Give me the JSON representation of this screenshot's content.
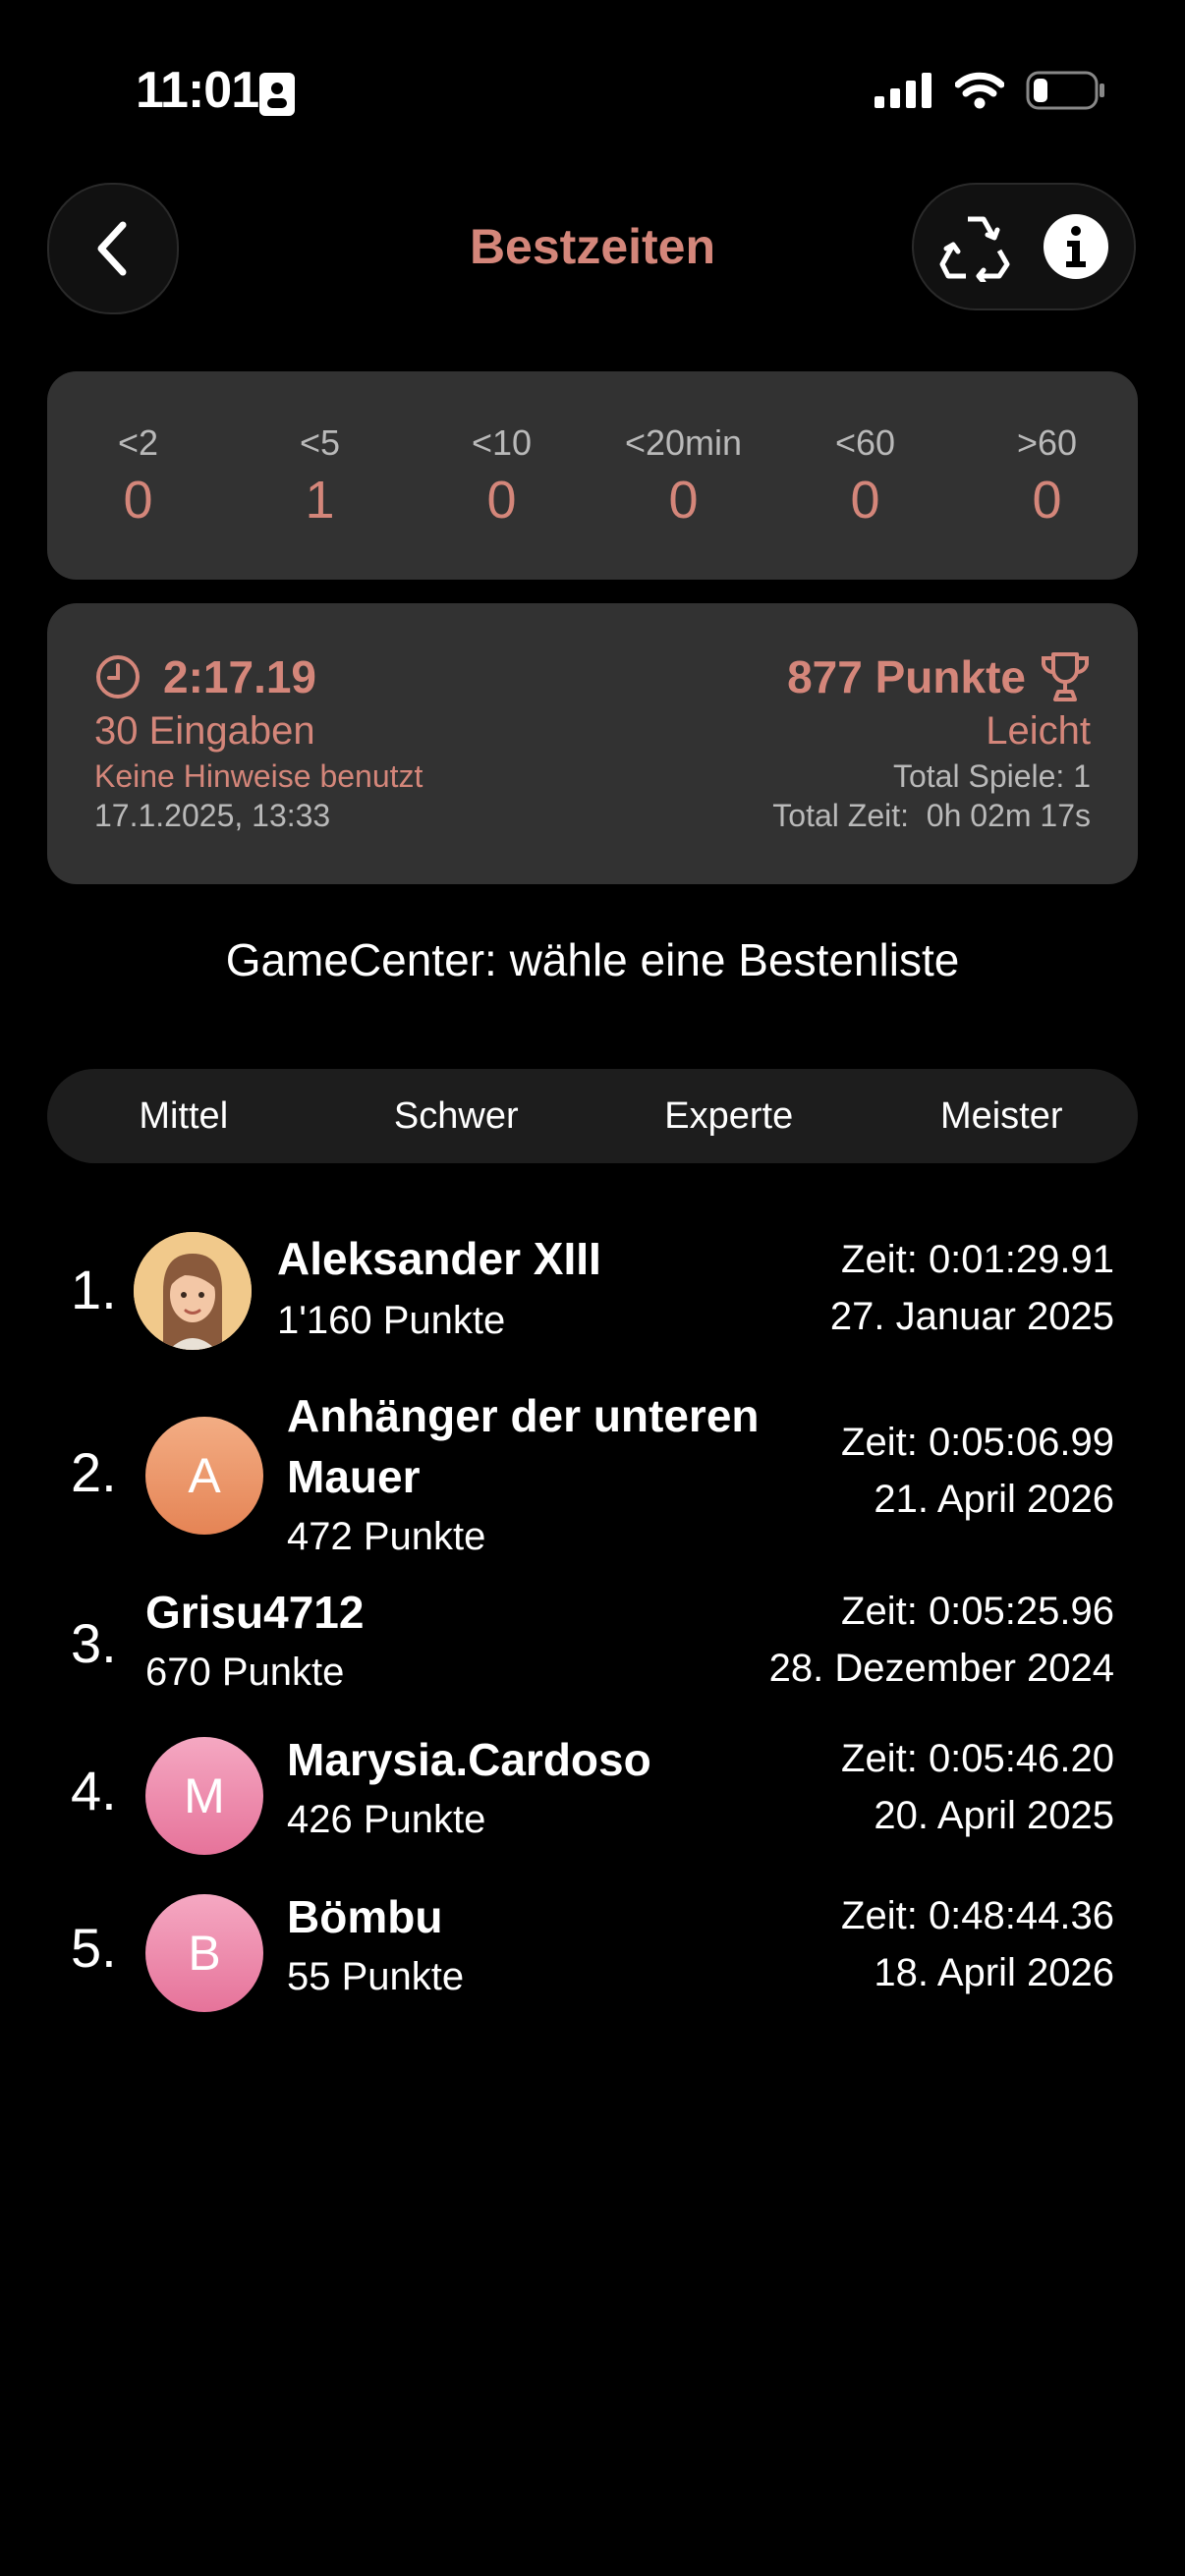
{
  "status_bar": {
    "time": "11:01"
  },
  "nav": {
    "title": "Bestzeiten"
  },
  "time_bins": [
    {
      "label": "<2",
      "count": "0"
    },
    {
      "label": "<5",
      "count": "1"
    },
    {
      "label": "<10",
      "count": "0"
    },
    {
      "label": "<20min",
      "count": "0"
    },
    {
      "label": "<60",
      "count": "0"
    },
    {
      "label": ">60",
      "count": "0"
    }
  ],
  "best_record": {
    "time": "2:17.19",
    "entries": "30 Eingaben",
    "hints": "Keine Hinweise benutzt",
    "date": "17.1.2025, 13:33",
    "points": "877 Punkte",
    "difficulty": "Leicht",
    "total_games": "Total Spiele: 1",
    "total_time": "Total Zeit:  0h 02m 17s"
  },
  "gamecenter": {
    "heading": "GameCenter: wähle eine Bestenliste"
  },
  "segments": [
    "Mittel",
    "Schwer",
    "Experte",
    "Meister"
  ],
  "leaderboard": [
    {
      "rank": "1.",
      "name": "Aleksander XIII",
      "points": "1'160 Punkte",
      "time": "Zeit: 0:01:29.91",
      "date": "27. Januar 2025",
      "avatar": "memoji",
      "avatar_letter": ""
    },
    {
      "rank": "2.",
      "name": "Anhänger der unteren Mauer",
      "points": "472 Punkte",
      "time": "Zeit: 0:05:06.99",
      "date": "21. April 2026",
      "avatar": "letter",
      "avatar_letter": "A"
    },
    {
      "rank": "3.",
      "name": "Grisu4712",
      "points": "670 Punkte",
      "time": "Zeit: 0:05:25.96",
      "date": "28. Dezember 2024",
      "avatar": "none",
      "avatar_letter": ""
    },
    {
      "rank": "4.",
      "name": "Marysia.Cardoso",
      "points": "426 Punkte",
      "time": "Zeit: 0:05:46.20",
      "date": "20. April 2025",
      "avatar": "letter",
      "avatar_letter": "M"
    },
    {
      "rank": "5.",
      "name": "Bömbu",
      "points": "55 Punkte",
      "time": "Zeit: 0:48:44.36",
      "date": "18. April 2026",
      "avatar": "letter",
      "avatar_letter": "B"
    }
  ],
  "colors": {
    "accent": "#d4867a",
    "card": "#323232",
    "avatar_orange": "#e9936a",
    "avatar_pink": "#ec8aa8"
  }
}
